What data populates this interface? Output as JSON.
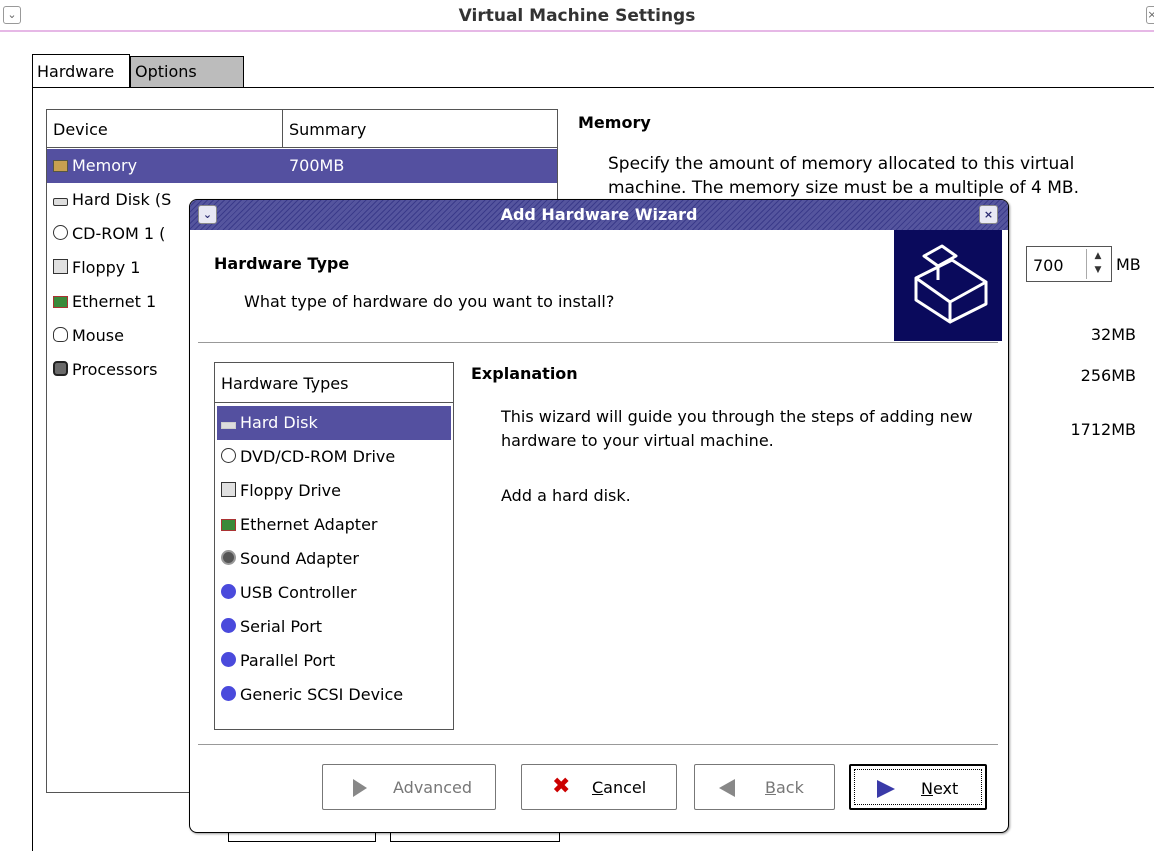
{
  "window": {
    "title": "Virtual Machine Settings"
  },
  "tabs": [
    {
      "label": "Hardware"
    },
    {
      "label": "Options"
    }
  ],
  "device_list": {
    "headers": {
      "device": "Device",
      "summary": "Summary"
    },
    "rows": [
      {
        "name": "Memory",
        "summary": "700MB",
        "icon": "memory-icon",
        "selected": true
      },
      {
        "name": "Hard Disk (S",
        "summary": "",
        "icon": "hard-disk-icon"
      },
      {
        "name": "CD-ROM 1 (",
        "summary": "",
        "icon": "cdrom-icon"
      },
      {
        "name": "Floppy 1",
        "summary": "",
        "icon": "floppy-icon"
      },
      {
        "name": "Ethernet 1",
        "summary": "",
        "icon": "ethernet-icon"
      },
      {
        "name": "Mouse",
        "summary": "",
        "icon": "mouse-icon"
      },
      {
        "name": "Processors",
        "summary": "",
        "icon": "processor-icon"
      }
    ]
  },
  "memory": {
    "title": "Memory",
    "description": "Specify the amount of memory allocated to this virtual machine. The memory size must be a multiple of 4 MB.",
    "value": "700",
    "unit": "MB",
    "scale_labels": [
      "32MB",
      "256MB",
      "1712MB"
    ]
  },
  "wizard": {
    "title": "Add Hardware Wizard",
    "section_title": "Hardware Type",
    "question": "What type of hardware do you want to install?",
    "list_header": "Hardware Types",
    "types": [
      {
        "label": "Hard Disk",
        "icon": "hard-disk-icon",
        "selected": true
      },
      {
        "label": "DVD/CD-ROM Drive",
        "icon": "cdrom-icon"
      },
      {
        "label": "Floppy Drive",
        "icon": "floppy-icon"
      },
      {
        "label": "Ethernet Adapter",
        "icon": "ethernet-icon"
      },
      {
        "label": "Sound Adapter",
        "icon": "sound-icon"
      },
      {
        "label": "USB Controller",
        "icon": "usb-icon"
      },
      {
        "label": "Serial Port",
        "icon": "serial-port-icon"
      },
      {
        "label": "Parallel Port",
        "icon": "parallel-port-icon"
      },
      {
        "label": "Generic SCSI Device",
        "icon": "scsi-icon"
      }
    ],
    "explanation_title": "Explanation",
    "explanation_text": "This wizard will guide you through the steps of adding new hardware to your virtual machine.",
    "explanation_detail": "Add a hard disk.",
    "buttons": {
      "advanced": "Advanced",
      "cancel_mnemonic": "C",
      "cancel_rest": "ancel",
      "back_mnemonic": "B",
      "back_rest": "ack",
      "next_mnemonic": "N",
      "next_rest": "ext"
    }
  },
  "colors": {
    "selection": "#5450a0",
    "banner": "#0a0a5c",
    "titlebar_accent": "#e6b8e6"
  }
}
